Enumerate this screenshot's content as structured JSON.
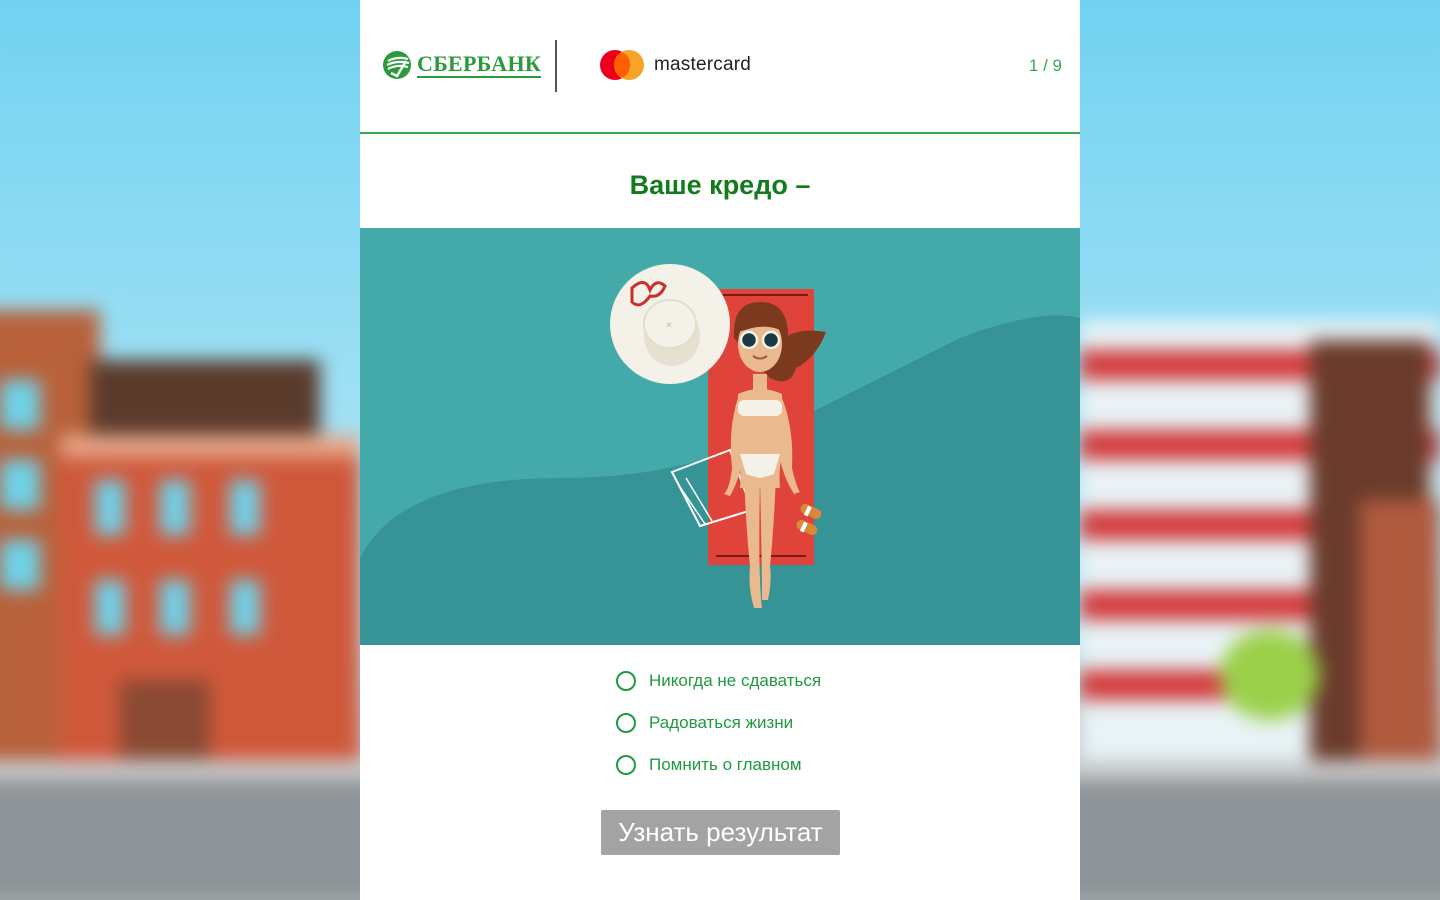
{
  "header": {
    "bank_name": "СБЕРБАНК",
    "partner_name": "mastercard",
    "page_counter": "1 / 9"
  },
  "question": {
    "title": "Ваше кредо –"
  },
  "options": [
    {
      "label": "Никогда не сдаваться",
      "selected": false
    },
    {
      "label": "Радоваться жизни",
      "selected": false
    },
    {
      "label": "Помнить о главном",
      "selected": false
    }
  ],
  "actions": {
    "result_label": "Узнать результат"
  },
  "colors": {
    "brand_green": "#137b1c",
    "accent_green": "#3aa652",
    "illustration_bg": "#44aaa9",
    "button_gray": "#a3a3a3"
  }
}
